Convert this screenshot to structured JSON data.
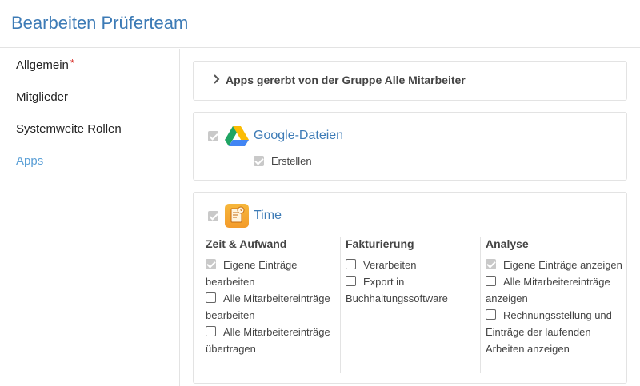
{
  "header": {
    "title": "Bearbeiten Prüferteam"
  },
  "sidebar": {
    "items": [
      {
        "label": "Allgemein",
        "required": "*"
      },
      {
        "label": "Mitglieder"
      },
      {
        "label": "Systemweite Rollen"
      },
      {
        "label": "Apps"
      }
    ],
    "active": "Apps"
  },
  "inherited": {
    "label": "Apps gererbt von der Gruppe Alle Mitarbeiter"
  },
  "apps": {
    "google": {
      "name": "Google-Dateien",
      "icon": "google-drive-icon",
      "checked": true,
      "permissions": [
        {
          "label": "Erstellen",
          "checked": true
        }
      ]
    },
    "time": {
      "name": "Time",
      "icon": "time-app-icon",
      "checked": true,
      "columns": [
        {
          "title": "Zeit & Aufwand",
          "permissions": [
            {
              "label": "Eigene Einträge bearbeiten",
              "checked": true
            },
            {
              "label": "Alle Mitarbeitereinträge bearbeiten",
              "checked": false
            },
            {
              "label": "Alle Mitarbeitereinträge übertragen",
              "checked": false
            }
          ]
        },
        {
          "title": "Fakturierung",
          "permissions": [
            {
              "label": "Verarbeiten",
              "checked": false
            },
            {
              "label": "Export in Buchhaltungssoftware",
              "checked": false
            }
          ]
        },
        {
          "title": "Analyse",
          "permissions": [
            {
              "label": "Eigene Einträge anzeigen",
              "checked": true
            },
            {
              "label": "Alle Mitarbeitereinträge anzeigen",
              "checked": false
            },
            {
              "label": "Rechnungsstellung und Einträge der laufenden Arbeiten anzeigen",
              "checked": false
            }
          ]
        }
      ]
    }
  },
  "colors": {
    "accent": "#3d7bb6",
    "active_nav": "#5a9fd6",
    "required": "#d9312b",
    "border": "#e3e3e3"
  }
}
